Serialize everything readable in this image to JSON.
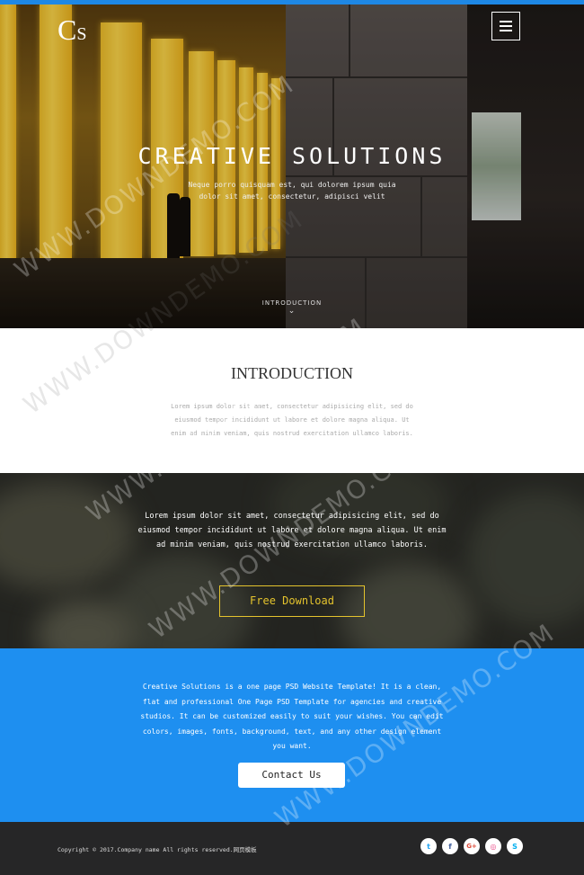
{
  "hero": {
    "logo_big": "C",
    "logo_small": "S",
    "title": "CREATIVE SOLUTIONS",
    "subtitle": "Neque porro quisquam est, qui dolorem ipsum quia dolor sit amet, consectetur, adipisci velit",
    "scroll_label": "INTRODUCTION",
    "scroll_icon": "chevron-down-icon",
    "menu_icon": "hamburger-menu-icon"
  },
  "intro": {
    "title": "INTRODUCTION",
    "text": "Lorem ipsum dolor sit amet, consectetur adipisicing elit, sed do eiusmod tempor incididunt ut labore et dolore magna aliqua. Ut enim ad minim veniam, quis nostrud exercitation ullamco laboris."
  },
  "download": {
    "text": "Lorem ipsum dolor sit amet, consectetur adipisicing elit, sed do eiusmod tempor incididunt ut labore et dolore magna aliqua. Ut enim ad minim veniam, quis nostrud exercitation ullamco laboris.",
    "button_label": "Free Download"
  },
  "about": {
    "text": "Creative Solutions is a one page PSD Website Template! It is a clean, flat and professional One Page PSD Template for agencies and creative studios. It can be customized easily to suit your wishes. You can edit colors, images, fonts, background, text, and any other design element you want.",
    "button_label": "Contact Us"
  },
  "footer": {
    "copyright": "Copyright © 2017.Company name All rights reserved.网页模板",
    "socials": [
      {
        "icon": "twitter-icon",
        "glyph": "t",
        "color": "#1da1f2"
      },
      {
        "icon": "facebook-icon",
        "glyph": "f",
        "color": "#3b5998"
      },
      {
        "icon": "google-plus-icon",
        "glyph": "G+",
        "color": "#dd4b39"
      },
      {
        "icon": "dribbble-icon",
        "glyph": "◎",
        "color": "#ea4c89"
      },
      {
        "icon": "skype-icon",
        "glyph": "S",
        "color": "#00aff0"
      }
    ]
  },
  "watermark": {
    "text": "WWW.DOWNDEMO.COM"
  },
  "colors": {
    "accent_blue": "#1e8ff0",
    "gold": "#e4c32d",
    "footer_bg": "#262627"
  }
}
